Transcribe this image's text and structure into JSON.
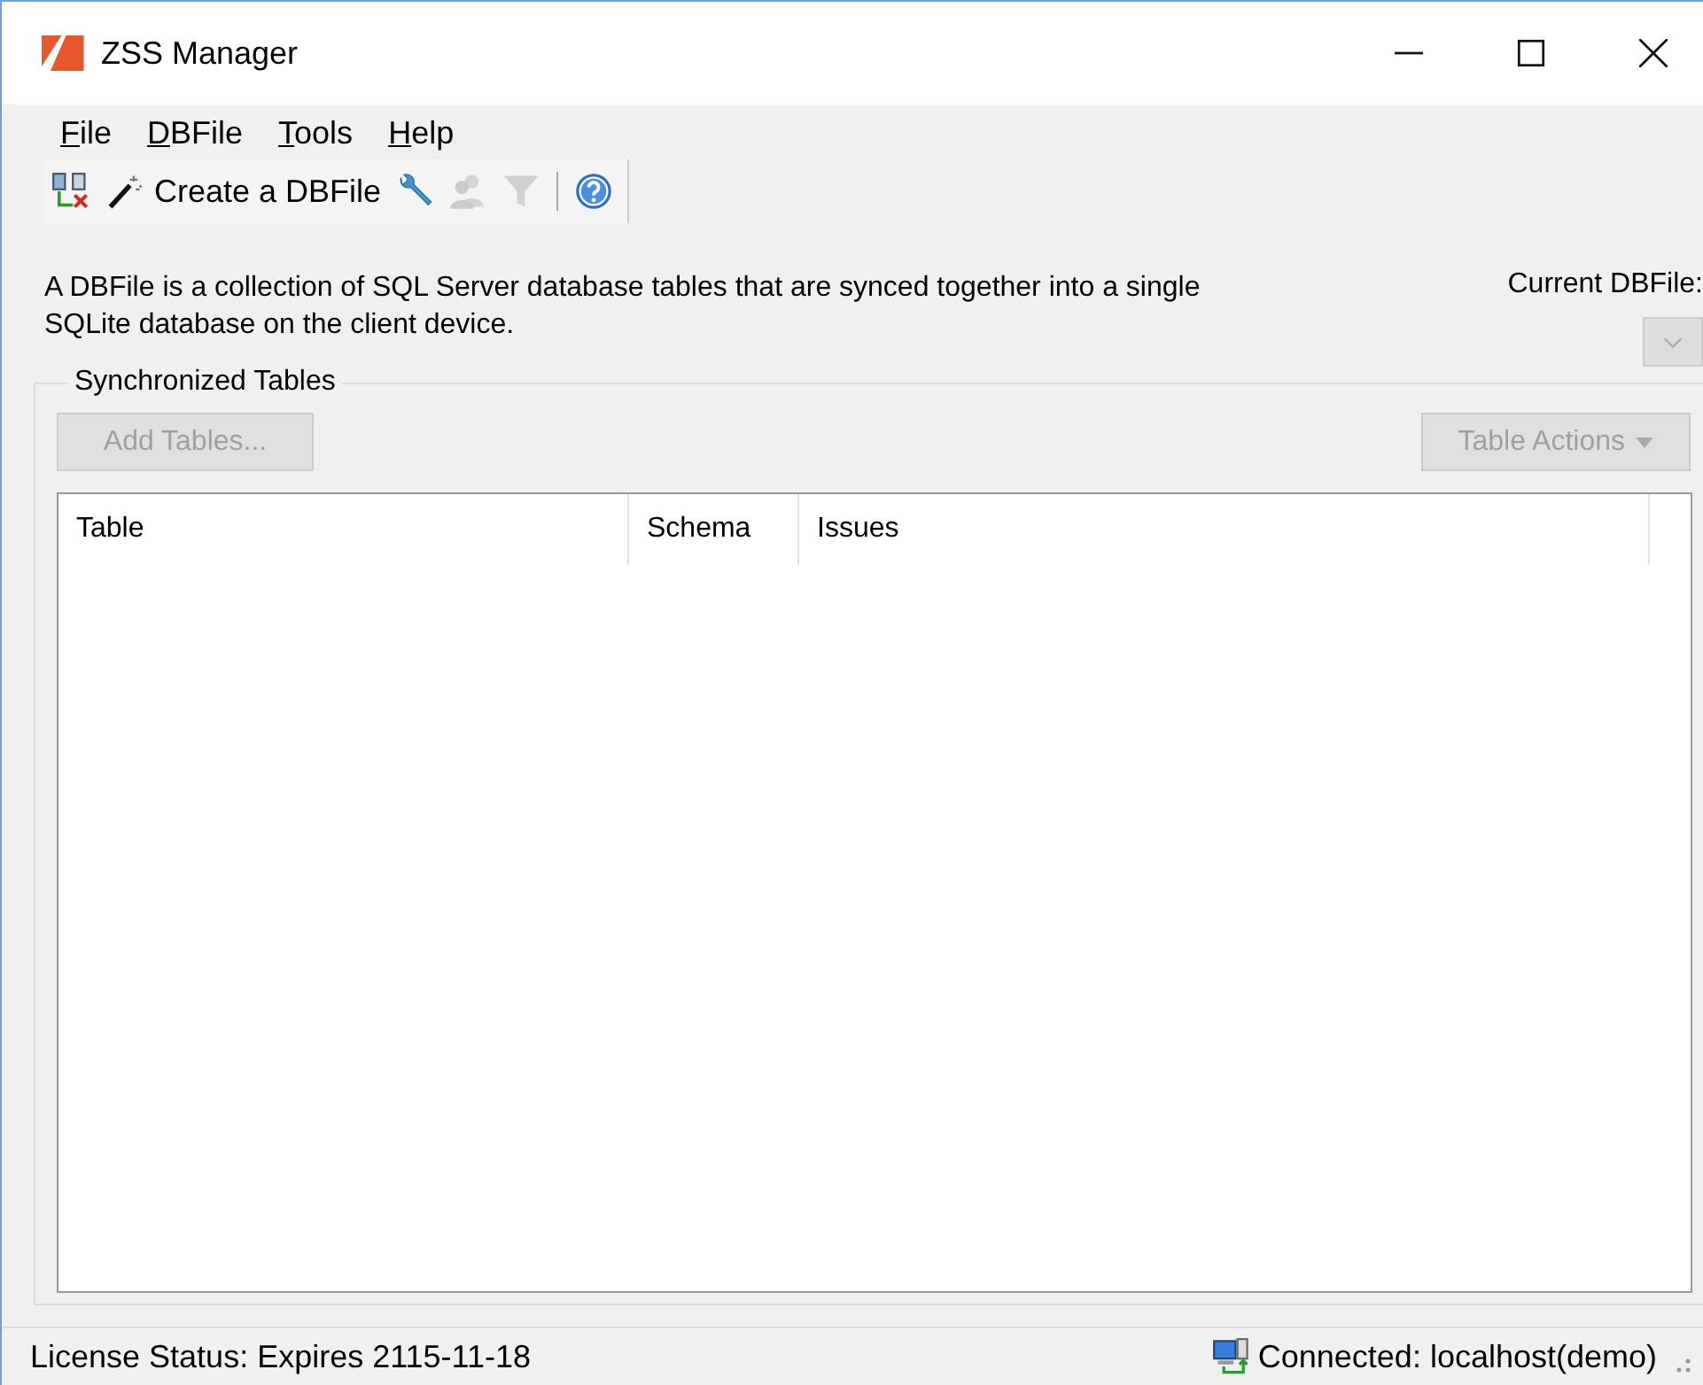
{
  "window": {
    "title": "ZSS Manager"
  },
  "menu": [
    {
      "label": "File"
    },
    {
      "label": "DBFile"
    },
    {
      "label": "Tools"
    },
    {
      "label": "Help"
    }
  ],
  "toolbar": [
    {
      "kind": "button",
      "disabled": false
    },
    {
      "kind": "button",
      "label": "Create a DBFile",
      "disabled": false
    },
    {
      "kind": "button",
      "disabled": false
    },
    {
      "kind": "button",
      "disabled": true
    },
    {
      "kind": "button",
      "disabled": true
    },
    {
      "kind": "separator"
    },
    {
      "kind": "button",
      "disabled": false
    }
  ],
  "description": "A DBFile is a collection of SQL Server database tables that are synced together into a single SQLite database on the client device.",
  "current_dbfile": {
    "label": "Current DBFile:",
    "disabled": true
  },
  "group": {
    "title": "Synchronized Tables",
    "add_button": {
      "label": "Add Tables...",
      "disabled": true
    },
    "actions_button": {
      "label": "Table Actions",
      "disabled": true
    }
  },
  "table": {
    "columns": [
      "Table",
      "Schema",
      "Issues"
    ]
  },
  "status_bar": {
    "license": "License Status: Expires 2115-11-18",
    "connection": "Connected: localhost(demo)"
  }
}
